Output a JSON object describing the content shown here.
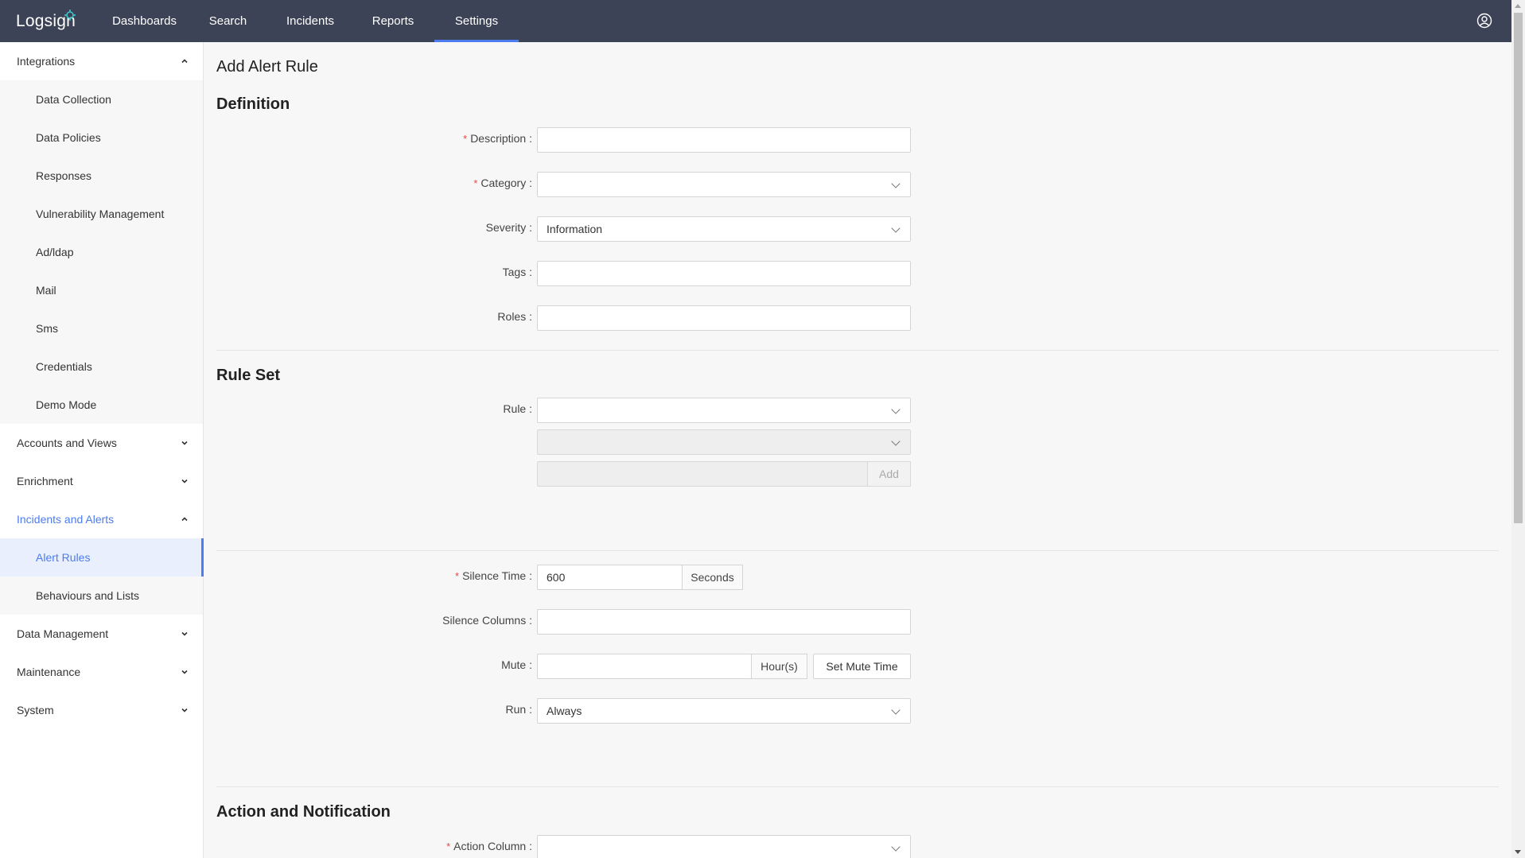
{
  "app": {
    "logo_text": "Logsign"
  },
  "nav": {
    "items": [
      {
        "label": "Dashboards"
      },
      {
        "label": "Search"
      },
      {
        "label": "Incidents"
      },
      {
        "label": "Reports"
      },
      {
        "label": "Settings"
      }
    ],
    "active": "Settings",
    "user_icon": "user-circle-icon"
  },
  "sidebar": {
    "integrations": {
      "label": "Integrations",
      "expanded": true,
      "items": [
        "Data Collection",
        "Data Policies",
        "Responses",
        "Vulnerability Management",
        "Ad/ldap",
        "Mail",
        "Sms",
        "Credentials",
        "Demo Mode"
      ]
    },
    "accounts": {
      "label": "Accounts and Views"
    },
    "enrichment": {
      "label": "Enrichment"
    },
    "incidents": {
      "label": "Incidents and Alerts",
      "expanded": true,
      "items": [
        "Alert Rules",
        "Behaviours and Lists"
      ],
      "active_item": "Alert Rules"
    },
    "data_management": {
      "label": "Data Management"
    },
    "maintenance": {
      "label": "Maintenance"
    },
    "system": {
      "label": "System"
    }
  },
  "page": {
    "title": "Add Alert Rule",
    "definition": {
      "title": "Definition",
      "description_label": "Description",
      "description_value": "",
      "category_label": "Category",
      "category_value": "",
      "severity_label": "Severity",
      "severity_value": "Information",
      "tags_label": "Tags",
      "tags_value": "",
      "roles_label": "Roles",
      "roles_value": ""
    },
    "rule_set": {
      "title": "Rule Set",
      "rule_label": "Rule",
      "rule_value": "",
      "add_button": "Add"
    },
    "timing": {
      "silence_time_label": "Silence Time",
      "silence_time_value": "600",
      "silence_time_unit": "Seconds",
      "silence_columns_label": "Silence Columns",
      "mute_label": "Mute",
      "mute_unit": "Hour(s)",
      "set_mute_button": "Set Mute Time",
      "run_label": "Run",
      "run_value": "Always"
    },
    "action": {
      "title": "Action and Notification",
      "action_column_label": "Action Column"
    }
  },
  "colors": {
    "topbar": "#3c4356",
    "accent": "#4c7cf0",
    "required": "#e24a4a"
  }
}
